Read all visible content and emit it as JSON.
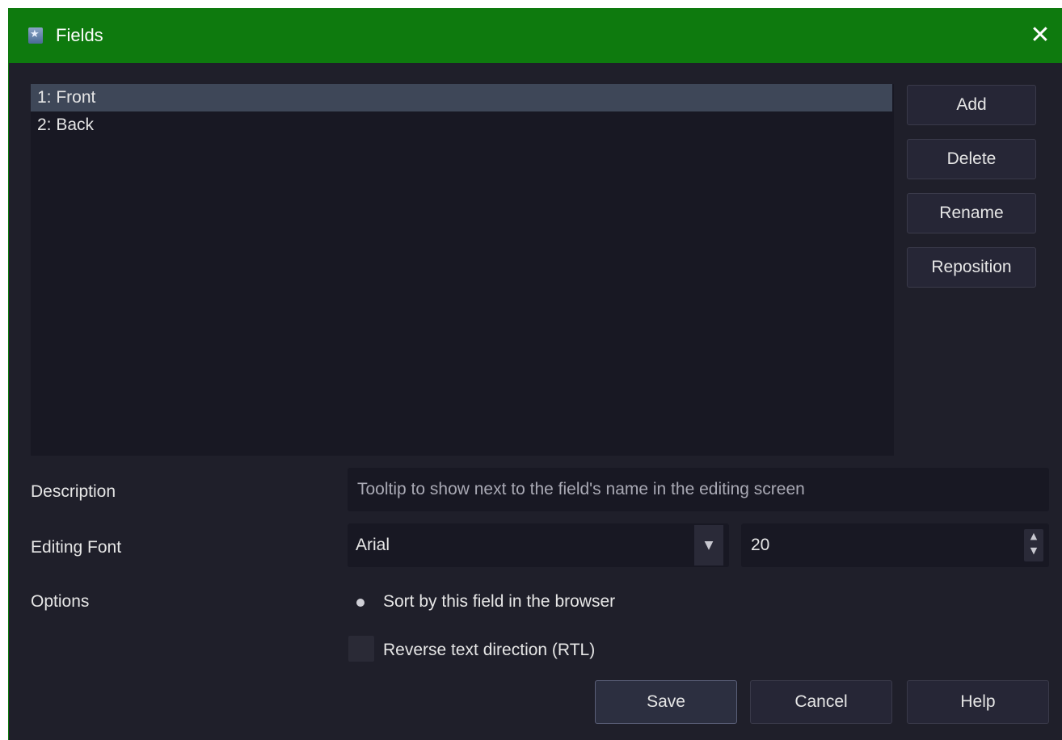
{
  "window": {
    "title": "Fields",
    "close_glyph": "✕",
    "icon": "anki-app-icon",
    "title_bar_color": "#0e7a0e"
  },
  "fields": {
    "items": [
      {
        "label": "1: Front",
        "selected": true
      },
      {
        "label": "2: Back",
        "selected": false
      }
    ]
  },
  "actions": {
    "add": "Add",
    "delete": "Delete",
    "rename": "Rename",
    "reposition": "Reposition"
  },
  "form": {
    "description_label": "Description",
    "description_placeholder": "Tooltip to show next to the field's name in the editing screen",
    "editing_font_label": "Editing Font",
    "font_value": "Arial",
    "font_size_value": "20",
    "options_label": "Options",
    "sort_option": "Sort by this field in the browser",
    "rtl_option": "Reverse text direction (RTL)"
  },
  "footer": {
    "save": "Save",
    "cancel": "Cancel",
    "help": "Help"
  }
}
